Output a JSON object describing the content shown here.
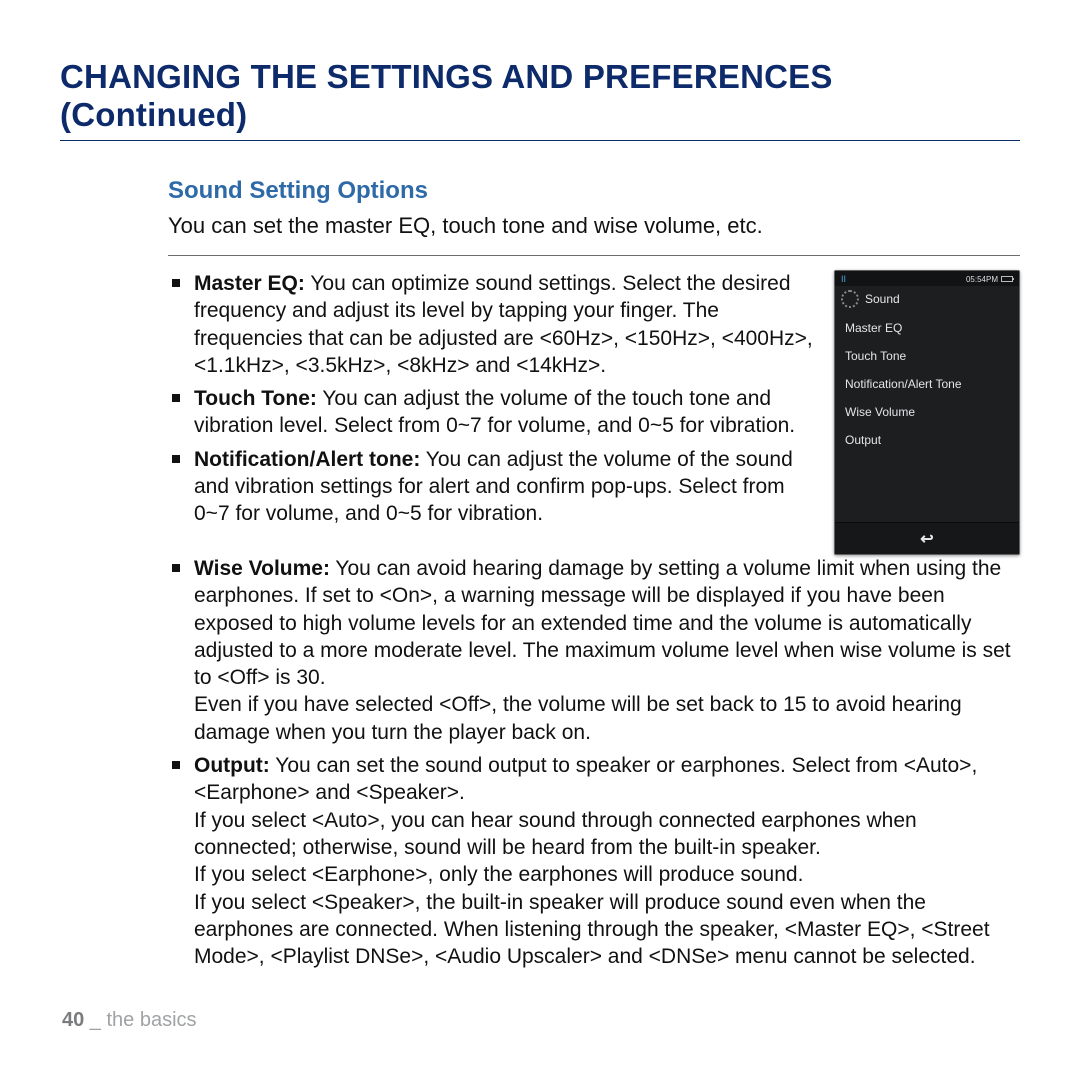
{
  "title": "CHANGING THE SETTINGS AND PREFERENCES (Continued)",
  "section_title": "Sound Setting Options",
  "section_intro": "You can set the master EQ, touch tone and wise volume, etc.",
  "bullets": [
    {
      "label": "Master EQ:",
      "text": " You can optimize sound settings. Select the desired frequency and adjust its level by tapping your finger. The frequencies that can be adjusted are <60Hz>, <150Hz>, <400Hz>, <1.1kHz>, <3.5kHz>, <8kHz> and <14kHz>."
    },
    {
      "label": "Touch Tone:",
      "text": " You can adjust the volume of the touch tone and vibration level. Select from 0~7 for volume, and 0~5 for vibration."
    },
    {
      "label": "Notification/Alert tone:",
      "text": " You can adjust the volume of the sound and vibration settings for alert and confirm pop-ups. Select from 0~7 for volume, and 0~5 for vibration."
    },
    {
      "label": "Wise Volume:",
      "text": " You can avoid hearing damage by setting a volume limit when using the earphones. If set to <On>, a warning message will be displayed if you have been exposed to high volume levels for an extended time and the volume is automatically adjusted to a more moderate level. The maximum volume level when wise volume is set to <Off> is 30.\nEven if you have selected <Off>, the volume will be set back to 15 to avoid hearing damage when you turn the player back on."
    },
    {
      "label": "Output:",
      "text": " You can set the sound output to speaker or earphones. Select from <Auto>, <Earphone> and <Speaker>.\nIf you select <Auto>, you can hear sound through connected earphones when connected; otherwise, sound will be heard from the built-in speaker.\nIf you select <Earphone>, only the earphones will produce sound.\nIf you select <Speaker>, the built-in speaker will produce sound even when the earphones are connected. When listening through the speaker, <Master EQ>, <Street Mode>, <Playlist DNSe>, <Audio Upscaler> and <DNSe> menu cannot be selected."
    }
  ],
  "device": {
    "status_left": "II",
    "status_time": "05:54PM",
    "header_label": "Sound",
    "menu": [
      "Master EQ",
      "Touch Tone",
      "Notification/Alert Tone",
      "Wise Volume",
      "Output"
    ]
  },
  "footer": {
    "page": "40",
    "sep": " _ ",
    "label": "the basics"
  }
}
